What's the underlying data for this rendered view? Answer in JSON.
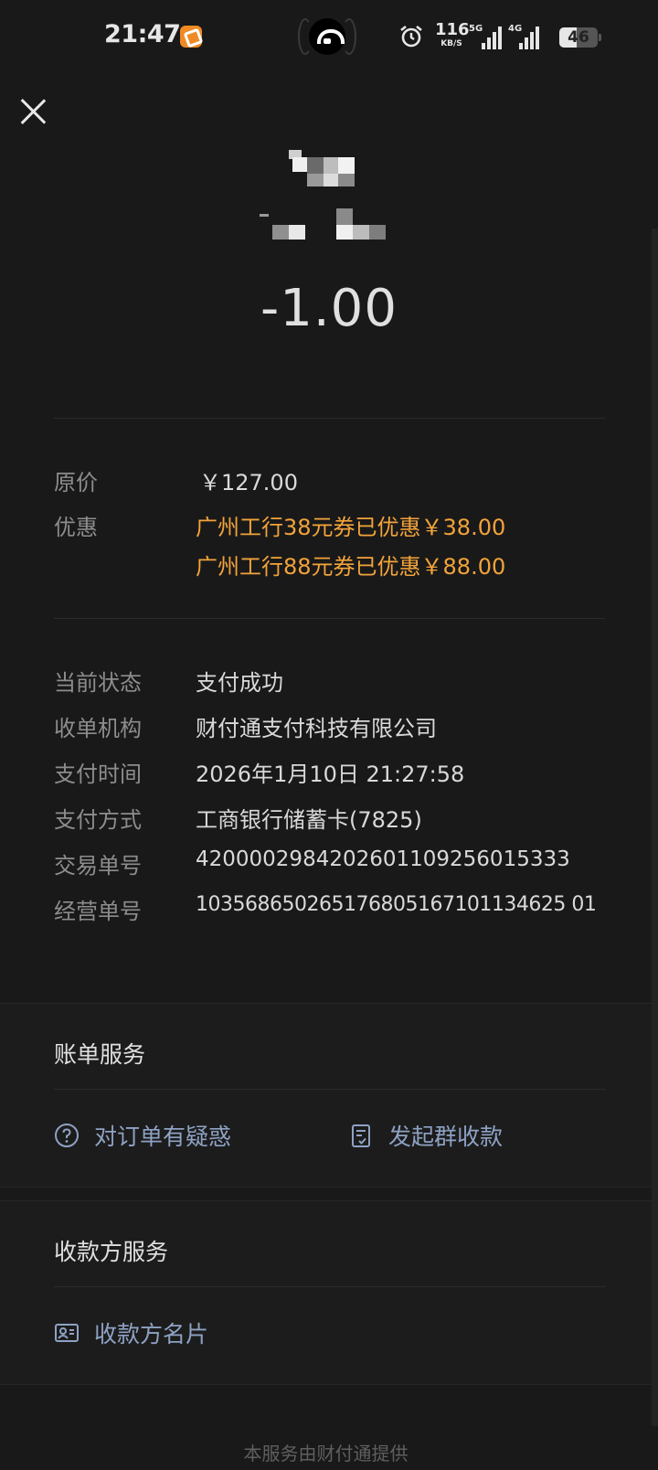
{
  "status_bar": {
    "time": "21:47",
    "net_speed": "116",
    "net_unit": "KB/S",
    "signal1_label": "5G",
    "signal2_label": "4G",
    "battery": "46",
    "battery_level": 0.46
  },
  "header": {
    "amount": "-1.00"
  },
  "price": {
    "original_label": "原价",
    "original_value": "￥127.00",
    "discount_label": "优惠",
    "discounts": [
      "广州工行38元券已优惠￥38.00",
      "广州工行88元券已优惠￥88.00"
    ]
  },
  "details": [
    {
      "label": "当前状态",
      "value": "支付成功"
    },
    {
      "label": "收单机构",
      "value": "财付通支付科技有限公司"
    },
    {
      "label": "支付时间",
      "value": "2026年1月10日 21:27:58"
    },
    {
      "label": "支付方式",
      "value": "工商银行储蓄卡(7825)"
    },
    {
      "label": "交易单号",
      "value": "4200002984202601109256015333"
    },
    {
      "label": "经营单号",
      "value": "103568650265176805167101134625 01"
    }
  ],
  "bill_service": {
    "title": "账单服务",
    "question": "对订单有疑惑",
    "group_collect": "发起群收款"
  },
  "payee_service": {
    "title": "收款方服务",
    "card": "收款方名片"
  },
  "footer": "本服务由财付通提供",
  "colors": {
    "background": "#191919",
    "accent_orange": "#f3a33a",
    "link_blue": "#8ea2c4"
  }
}
